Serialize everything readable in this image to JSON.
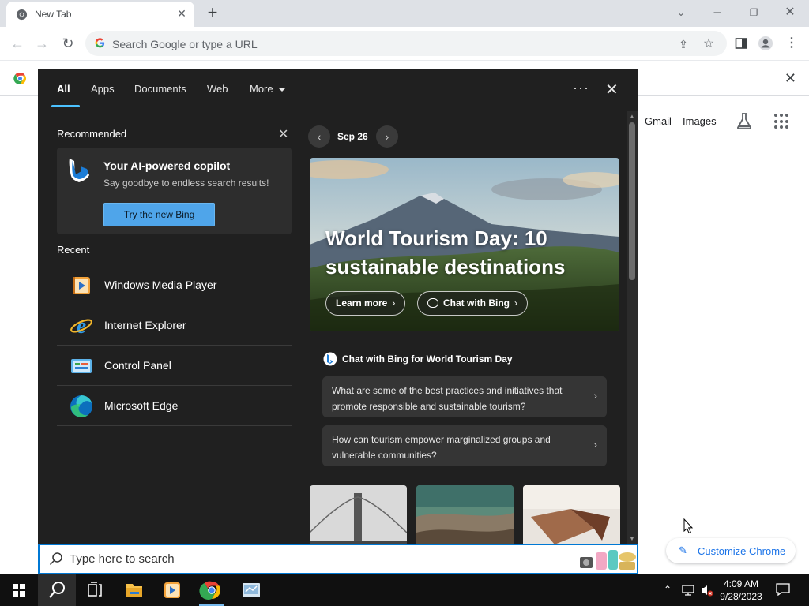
{
  "browser": {
    "tab_title": "New Tab",
    "omnibox_placeholder": "Search Google or type a URL"
  },
  "ntp": {
    "gmail": "Gmail",
    "images": "Images",
    "customize": "Customize Chrome"
  },
  "search_panel": {
    "tabs": [
      "All",
      "Apps",
      "Documents",
      "Web",
      "More"
    ],
    "recommended": {
      "title": "Recommended",
      "card_title": "Your AI-powered copilot",
      "card_subtitle": "Say goodbye to endless search results!",
      "card_button": "Try the new Bing"
    },
    "recent": {
      "title": "Recent",
      "items": [
        {
          "label": "Windows Media Player",
          "icon": "media-player-icon"
        },
        {
          "label": "Internet Explorer",
          "icon": "internet-explorer-icon"
        },
        {
          "label": "Control Panel",
          "icon": "control-panel-icon"
        },
        {
          "label": "Microsoft Edge",
          "icon": "edge-icon"
        }
      ]
    },
    "highlight": {
      "date": "Sep 26",
      "hero_title": "World Tourism Day: 10 sustainable destinations",
      "learn_more": "Learn more",
      "chat_with_bing": "Chat with Bing"
    },
    "chat_section": {
      "title": "Chat with Bing for World Tourism Day",
      "prompts": [
        "What are some of the best practices and initiatives that promote responsible and sustainable tourism?",
        "How can tourism empower marginalized groups and vulnerable communities?"
      ]
    }
  },
  "searchbox": {
    "placeholder": "Type here to search"
  },
  "taskbar": {
    "time": "4:09 AM",
    "date": "9/28/2023"
  },
  "colors": {
    "accent": "#0078d4",
    "panel_bg": "#202020",
    "bing_button": "#4fa5ea",
    "chrome_link": "#1a73e8"
  }
}
